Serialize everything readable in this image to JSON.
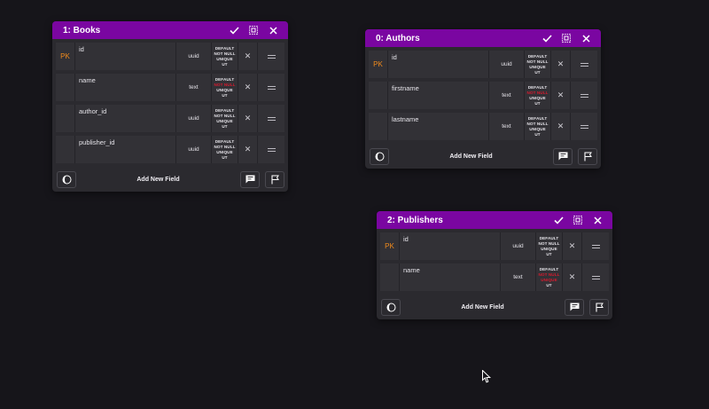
{
  "tables": [
    {
      "title": "1: Books",
      "fields": [
        {
          "pk": "PK",
          "name": "id",
          "type": "uuid",
          "constraints": [
            {
              "text": "DEFAULT",
              "on": true
            },
            {
              "text": "NOT NULL",
              "on": true
            },
            {
              "text": "UNIQUE",
              "on": true
            },
            {
              "text": "UT",
              "on": true
            }
          ]
        },
        {
          "pk": "",
          "name": "name",
          "type": "text",
          "constraints": [
            {
              "text": "DEFAULT",
              "on": true
            },
            {
              "text": "NOT NULL",
              "on": false
            },
            {
              "text": "UNIQUE",
              "on": true
            },
            {
              "text": "UT",
              "on": true
            }
          ]
        },
        {
          "pk": "",
          "name": "author_id",
          "type": "uuid",
          "constraints": [
            {
              "text": "DEFAULT",
              "on": true
            },
            {
              "text": "NOT NULL",
              "on": true
            },
            {
              "text": "UNIQUE",
              "on": true
            },
            {
              "text": "UT",
              "on": true
            }
          ]
        },
        {
          "pk": "",
          "name": "publisher_id",
          "type": "uuid",
          "constraints": [
            {
              "text": "DEFAULT",
              "on": true
            },
            {
              "text": "NOT NULL",
              "on": true
            },
            {
              "text": "UNIQUE",
              "on": true
            },
            {
              "text": "UT",
              "on": true
            }
          ]
        }
      ],
      "add_field_label": "Add New Field"
    },
    {
      "title": "0: Authors",
      "fields": [
        {
          "pk": "PK",
          "name": "id",
          "type": "uuid",
          "constraints": [
            {
              "text": "DEFAULT",
              "on": true
            },
            {
              "text": "NOT NULL",
              "on": true
            },
            {
              "text": "UNIQUE",
              "on": true
            },
            {
              "text": "UT",
              "on": true
            }
          ]
        },
        {
          "pk": "",
          "name": "firstname",
          "type": "text",
          "constraints": [
            {
              "text": "DEFAULT",
              "on": true
            },
            {
              "text": "NOT NULL",
              "on": false
            },
            {
              "text": "UNIQUE",
              "on": true
            },
            {
              "text": "UT",
              "on": true
            }
          ]
        },
        {
          "pk": "",
          "name": "lastname",
          "type": "text",
          "constraints": [
            {
              "text": "DEFAULT",
              "on": true
            },
            {
              "text": "NOT NULL",
              "on": true
            },
            {
              "text": "UNIQUE",
              "on": true
            },
            {
              "text": "UT",
              "on": true
            }
          ]
        }
      ],
      "add_field_label": "Add New Field"
    },
    {
      "title": "2: Publishers",
      "fields": [
        {
          "pk": "PK",
          "name": "id",
          "type": "uuid",
          "constraints": [
            {
              "text": "DEFAULT",
              "on": true
            },
            {
              "text": "NOT NULL",
              "on": true
            },
            {
              "text": "UNIQUE",
              "on": true
            },
            {
              "text": "UT",
              "on": true
            }
          ]
        },
        {
          "pk": "",
          "name": "name",
          "type": "text",
          "constraints": [
            {
              "text": "DEFAULT",
              "on": true
            },
            {
              "text": "NOT NULL",
              "on": false
            },
            {
              "text": "UNIQUE",
              "on": false
            },
            {
              "text": "UT",
              "on": true
            }
          ]
        }
      ],
      "add_field_label": "Add New Field"
    }
  ],
  "icons": {
    "header": [
      "check-icon",
      "select-all-icon",
      "close-icon"
    ],
    "row": [
      "delete-x-icon",
      "drag-handle-icon"
    ],
    "footer": [
      "theme-toggle-icon",
      "comment-icon",
      "flag-icon"
    ],
    "pointer": "mouse-pointer-icon"
  },
  "colors": {
    "header_bg": "#7a06a1",
    "card_bg": "#2b2a2f",
    "row_bg": "#323136",
    "page_bg": "#16151a",
    "pk_color": "#f08a1c",
    "constraint_off": "#d81a2e"
  }
}
